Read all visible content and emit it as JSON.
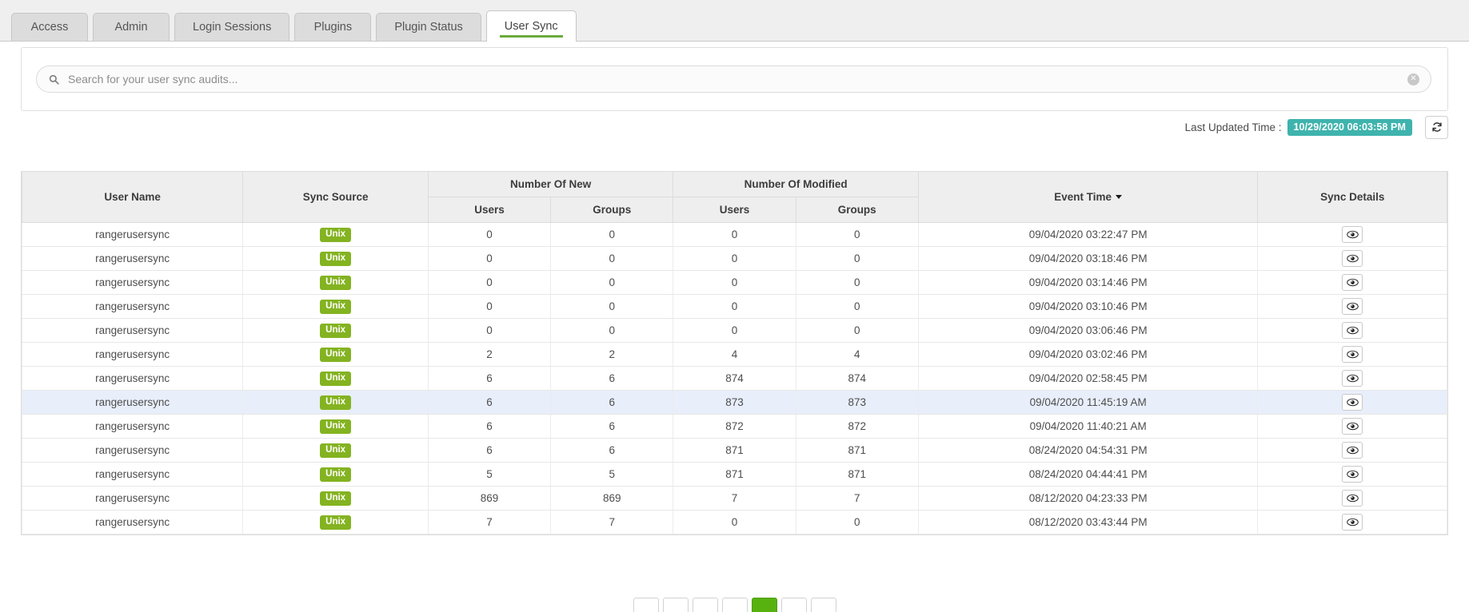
{
  "tabs": [
    {
      "label": "Access",
      "active": false
    },
    {
      "label": "Admin",
      "active": false
    },
    {
      "label": "Login Sessions",
      "active": false
    },
    {
      "label": "Plugins",
      "active": false
    },
    {
      "label": "Plugin Status",
      "active": false
    },
    {
      "label": "User Sync",
      "active": true
    }
  ],
  "search": {
    "placeholder": "Search for your user sync audits...",
    "value": "",
    "icon": "search-icon",
    "clear_icon": "clear-circle-icon"
  },
  "status": {
    "last_updated_label": "Last Updated Time :",
    "last_updated_value": "10/29/2020 06:03:58 PM",
    "badge_color": "#3fb3ad",
    "refresh_icon": "refresh-icon"
  },
  "table": {
    "group_headers": {
      "new": "Number Of New",
      "modified": "Number Of Modified"
    },
    "headers": {
      "user_name": "User Name",
      "sync_source": "Sync Source",
      "new_users": "Users",
      "new_groups": "Groups",
      "mod_users": "Users",
      "mod_groups": "Groups",
      "event_time": "Event Time",
      "sync_details": "Sync Details"
    },
    "sort": {
      "column": "Event Time",
      "direction": "desc"
    },
    "detail_icon": "eye-icon",
    "rows": [
      {
        "user_name": "rangerusersync",
        "sync_source": "Unix",
        "new_users": "0",
        "new_groups": "0",
        "mod_users": "0",
        "mod_groups": "0",
        "event_time": "09/04/2020 03:22:47 PM",
        "highlight": false
      },
      {
        "user_name": "rangerusersync",
        "sync_source": "Unix",
        "new_users": "0",
        "new_groups": "0",
        "mod_users": "0",
        "mod_groups": "0",
        "event_time": "09/04/2020 03:18:46 PM",
        "highlight": false
      },
      {
        "user_name": "rangerusersync",
        "sync_source": "Unix",
        "new_users": "0",
        "new_groups": "0",
        "mod_users": "0",
        "mod_groups": "0",
        "event_time": "09/04/2020 03:14:46 PM",
        "highlight": false
      },
      {
        "user_name": "rangerusersync",
        "sync_source": "Unix",
        "new_users": "0",
        "new_groups": "0",
        "mod_users": "0",
        "mod_groups": "0",
        "event_time": "09/04/2020 03:10:46 PM",
        "highlight": false
      },
      {
        "user_name": "rangerusersync",
        "sync_source": "Unix",
        "new_users": "0",
        "new_groups": "0",
        "mod_users": "0",
        "mod_groups": "0",
        "event_time": "09/04/2020 03:06:46 PM",
        "highlight": false
      },
      {
        "user_name": "rangerusersync",
        "sync_source": "Unix",
        "new_users": "2",
        "new_groups": "2",
        "mod_users": "4",
        "mod_groups": "4",
        "event_time": "09/04/2020 03:02:46 PM",
        "highlight": false
      },
      {
        "user_name": "rangerusersync",
        "sync_source": "Unix",
        "new_users": "6",
        "new_groups": "6",
        "mod_users": "874",
        "mod_groups": "874",
        "event_time": "09/04/2020 02:58:45 PM",
        "highlight": false
      },
      {
        "user_name": "rangerusersync",
        "sync_source": "Unix",
        "new_users": "6",
        "new_groups": "6",
        "mod_users": "873",
        "mod_groups": "873",
        "event_time": "09/04/2020 11:45:19 AM",
        "highlight": true
      },
      {
        "user_name": "rangerusersync",
        "sync_source": "Unix",
        "new_users": "6",
        "new_groups": "6",
        "mod_users": "872",
        "mod_groups": "872",
        "event_time": "09/04/2020 11:40:21 AM",
        "highlight": false
      },
      {
        "user_name": "rangerusersync",
        "sync_source": "Unix",
        "new_users": "6",
        "new_groups": "6",
        "mod_users": "871",
        "mod_groups": "871",
        "event_time": "08/24/2020 04:54:31 PM",
        "highlight": false
      },
      {
        "user_name": "rangerusersync",
        "sync_source": "Unix",
        "new_users": "5",
        "new_groups": "5",
        "mod_users": "871",
        "mod_groups": "871",
        "event_time": "08/24/2020 04:44:41 PM",
        "highlight": false
      },
      {
        "user_name": "rangerusersync",
        "sync_source": "Unix",
        "new_users": "869",
        "new_groups": "869",
        "mod_users": "7",
        "mod_groups": "7",
        "event_time": "08/12/2020 04:23:33 PM",
        "highlight": false
      },
      {
        "user_name": "rangerusersync",
        "sync_source": "Unix",
        "new_users": "7",
        "new_groups": "7",
        "mod_users": "0",
        "mod_groups": "0",
        "event_time": "08/12/2020 03:43:44 PM",
        "highlight": false
      }
    ]
  },
  "pagination": {
    "items": [
      {
        "label": "",
        "active": false
      },
      {
        "label": "",
        "active": false
      },
      {
        "label": "",
        "active": false
      },
      {
        "label": "",
        "active": false
      },
      {
        "label": "",
        "active": true
      },
      {
        "label": "",
        "active": false
      },
      {
        "label": "",
        "active": false
      }
    ],
    "active_color": "#57b10f"
  }
}
